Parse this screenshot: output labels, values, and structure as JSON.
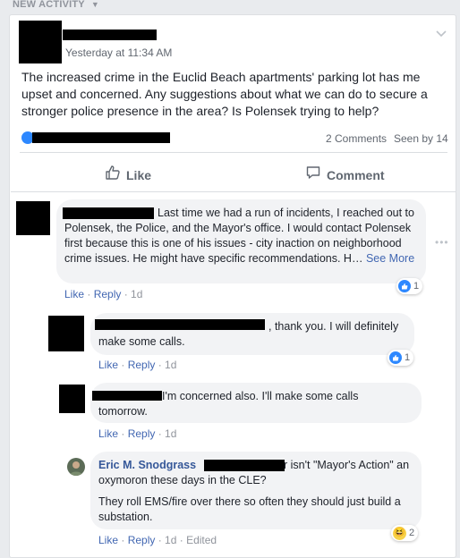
{
  "header": {
    "title": "NEW ACTIVITY"
  },
  "post": {
    "timestamp": "Yesterday at 11:34 AM",
    "text": "The increased crime in the Euclid Beach apartments' parking lot has me upset and concerned. Any suggestions about what we can do to secure a stronger police presence in the area? Is Polensek trying to help?",
    "comments_count": "2 Comments",
    "seen_by": "Seen by 14"
  },
  "actions": {
    "like": "Like",
    "comment": "Comment"
  },
  "comments": [
    {
      "text": "Last time we had a run of incidents, I reached out to Polensek, the Police, and the Mayor's office. I would contact Polensek first because this is one of his issues - city inaction on neighborhood crime issues. He might have specific recommendations. H…",
      "see_more": "See More",
      "like": "Like",
      "reply": "Reply",
      "time": "1d",
      "reactions": "1"
    },
    {
      "text": ", thank you. I will definitely make some calls.",
      "like": "Like",
      "reply": "Reply",
      "time": "1d",
      "reactions": "1"
    },
    {
      "text": "I'm concerned also. I'll make some calls tomorrow.",
      "like": "Like",
      "reply": "Reply",
      "time": "1d"
    },
    {
      "author": "Eric M. Snodgrass",
      "text_line1": "r isn't \"Mayor's Action\" an",
      "text_line2": "oxymoron these days in the CLE?",
      "text_p2": "They roll EMS/fire over there so often they should just build a substation.",
      "like": "Like",
      "reply": "Reply",
      "time": "1d",
      "edited": "Edited",
      "reactions": "2"
    }
  ],
  "colors": {
    "link": "#365899",
    "action_link": "#4267b2",
    "bubble": "#f2f3f5",
    "like_blue": "#2d88ff"
  }
}
